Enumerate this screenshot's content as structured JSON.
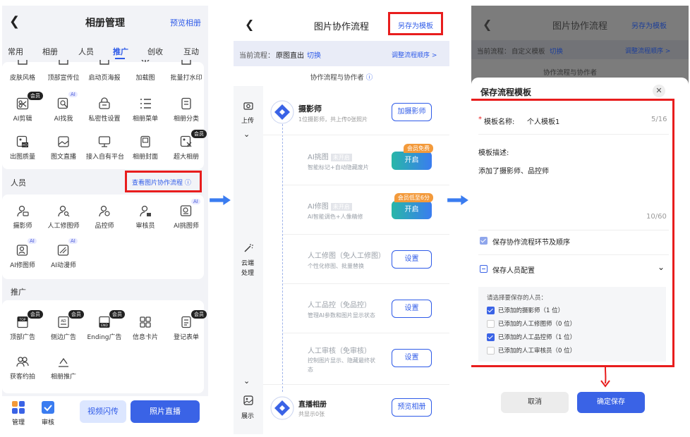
{
  "p1": {
    "title": "相册管理",
    "preview": "预览相册",
    "tabs": [
      "常用",
      "相册",
      "人员",
      "推广",
      "创收",
      "互动"
    ],
    "row0": [
      "皮肤风格",
      "顶部宣传位",
      "启动页海报",
      "加载图",
      "批量打水印"
    ],
    "row1": [
      "AI剪辑",
      "AI找我",
      "私密性设置",
      "相册菜单",
      "相册分类"
    ],
    "row2": [
      "出图质量",
      "图文直播",
      "接入自有平台",
      "相册封面",
      "超大相册"
    ],
    "people_section": "人员",
    "view_flow": "查看图片协作流程",
    "people": [
      "摄影师",
      "人工修图师",
      "品控师",
      "审核员",
      "AI挑图师"
    ],
    "people2": [
      "AI修图师",
      "AI动漫师"
    ],
    "promo_section": "推广",
    "promo": [
      "顶部广告",
      "侧边广告",
      "Ending广告",
      "信息卡片",
      "登记表单"
    ],
    "promo2": [
      "获客约拍",
      "相册推广"
    ],
    "vip": "会员",
    "ai": "AI",
    "bottom": {
      "manage": "管理",
      "audit": "审核",
      "video": "视频闪传",
      "photo_live": "照片直播"
    }
  },
  "p2": {
    "title": "图片协作流程",
    "save_template": "另存为模板",
    "current_label": "当前流程：",
    "current_value": "原图直出",
    "switch": "切换",
    "adjust": "调整流程顺序 >",
    "subtitle": "协作流程与协作者",
    "side_upload": "上传",
    "side_cloud": "云端",
    "side_process": "处理",
    "side_show": "展示",
    "photographer": {
      "title": "摄影师",
      "sub": "1位摄影师，共上传0张照片",
      "btn": "加摄影师"
    },
    "ai_pick": {
      "title": "AI挑图",
      "tag": "未开启",
      "sub": "智能标记+自动隐藏废片",
      "btn": "开启",
      "badge": "会员免费"
    },
    "ai_retouch": {
      "title": "AI修图",
      "tag": "未开启",
      "sub": "AI智能调色+人像精修",
      "btn": "开启",
      "badge": "会员低至6分"
    },
    "manual_retouch": {
      "title": "人工修图（免人工修图）",
      "sub": "个性化修图、批量替换",
      "btn": "设置"
    },
    "manual_qc": {
      "title": "人工品控（免品控）",
      "sub": "管理AI参数和图片显示状态",
      "btn": "设置"
    },
    "manual_audit": {
      "title": "人工审核（免审核）",
      "sub1": "控制图片显示、隐藏最终状",
      "sub2": "态",
      "btn": "设置"
    },
    "live_album": {
      "title": "直播相册",
      "sub": "共显示0张",
      "btn": "预览相册"
    }
  },
  "p3": {
    "title": "图片协作流程",
    "save_template": "另存为模板",
    "current_label": "当前流程：",
    "current_value": "自定义模板",
    "switch": "切换",
    "adjust": "调整流程顺序 >",
    "subtitle": "协作流程与协作者",
    "modal_title": "保存流程模板",
    "name_label": "模板名称:",
    "name_value": "个人模板1",
    "name_count": "5/16",
    "desc_label": "模板描述:",
    "desc_value": "添加了摄影师、品控师",
    "desc_count": "10/60",
    "save_steps": "保存协作流程环节及顺序",
    "save_people": "保存人员配置",
    "choose_label": "请选择要保存的人员：",
    "options": [
      {
        "label": "已添加的摄影师（1 位）",
        "checked": true
      },
      {
        "label": "已添加的人工修图师（0 位）",
        "checked": false
      },
      {
        "label": "已添加的人工品控师（1 位）",
        "checked": true
      },
      {
        "label": "已添加的人工审核员（0 位）",
        "checked": false
      }
    ],
    "cancel": "取消",
    "confirm": "确定保存"
  }
}
